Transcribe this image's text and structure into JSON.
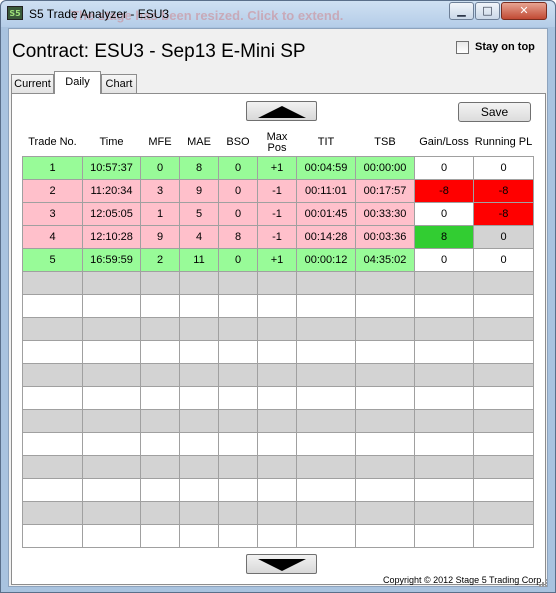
{
  "window": {
    "title": "S5 Trade Analyzer - ESU3",
    "icon_label": "S5",
    "overlay_text": "The stage has been resized. Click to extend.",
    "buttons": [
      "minimize-icon",
      "maximize-icon",
      "close-icon"
    ]
  },
  "header": {
    "contract_label": "Contract: ESU3 - Sep13 E-Mini SP",
    "stay_on_top_label": "Stay on top",
    "stay_on_top_checked": false
  },
  "tabs": [
    {
      "label": "Current",
      "selected": false
    },
    {
      "label": "Daily",
      "selected": true
    },
    {
      "label": "Chart",
      "selected": false
    }
  ],
  "toolbar": {
    "save_label": "Save",
    "scroll_up_icon": "triangle-up-icon",
    "scroll_down_icon": "triangle-down-icon"
  },
  "table": {
    "columns": [
      "Trade No.",
      "Time",
      "MFE",
      "MAE",
      "BSO",
      "Max Pos",
      "TIT",
      "TSB",
      "Gain/Loss",
      "Running PL"
    ],
    "rows": [
      [
        "1",
        "10:57:37",
        "0",
        "8",
        "0",
        "+1",
        "00:04:59",
        "00:00:00",
        "0",
        "0"
      ],
      [
        "2",
        "11:20:34",
        "3",
        "9",
        "0",
        "-1",
        "00:11:01",
        "00:17:57",
        "-8",
        "-8"
      ],
      [
        "3",
        "12:05:05",
        "1",
        "5",
        "0",
        "-1",
        "00:01:45",
        "00:33:30",
        "0",
        "-8"
      ],
      [
        "4",
        "12:10:28",
        "9",
        "4",
        "8",
        "-1",
        "00:14:28",
        "00:03:36",
        "8",
        "0"
      ],
      [
        "5",
        "16:59:59",
        "2",
        "11",
        "0",
        "+1",
        "00:00:12",
        "04:35:02",
        "0",
        "0"
      ]
    ],
    "row_colors": [
      "green",
      "pink",
      "pink",
      "pink",
      "green"
    ],
    "gain_loss_colors": [
      "white",
      "red",
      "white",
      "green",
      "white"
    ],
    "running_pl_colors": [
      "white",
      "red",
      "red",
      "gray",
      "white"
    ],
    "empty_row_count": 12
  },
  "colors": {
    "row_green": "#98fb98",
    "row_pink": "#ffc0cb",
    "cell_red": "#ff0000",
    "cell_green": "#32cd32",
    "cell_gray": "#d3d3d3"
  },
  "footer": {
    "copyright": "Copyright © 2012 Stage 5 Trading Corp."
  }
}
